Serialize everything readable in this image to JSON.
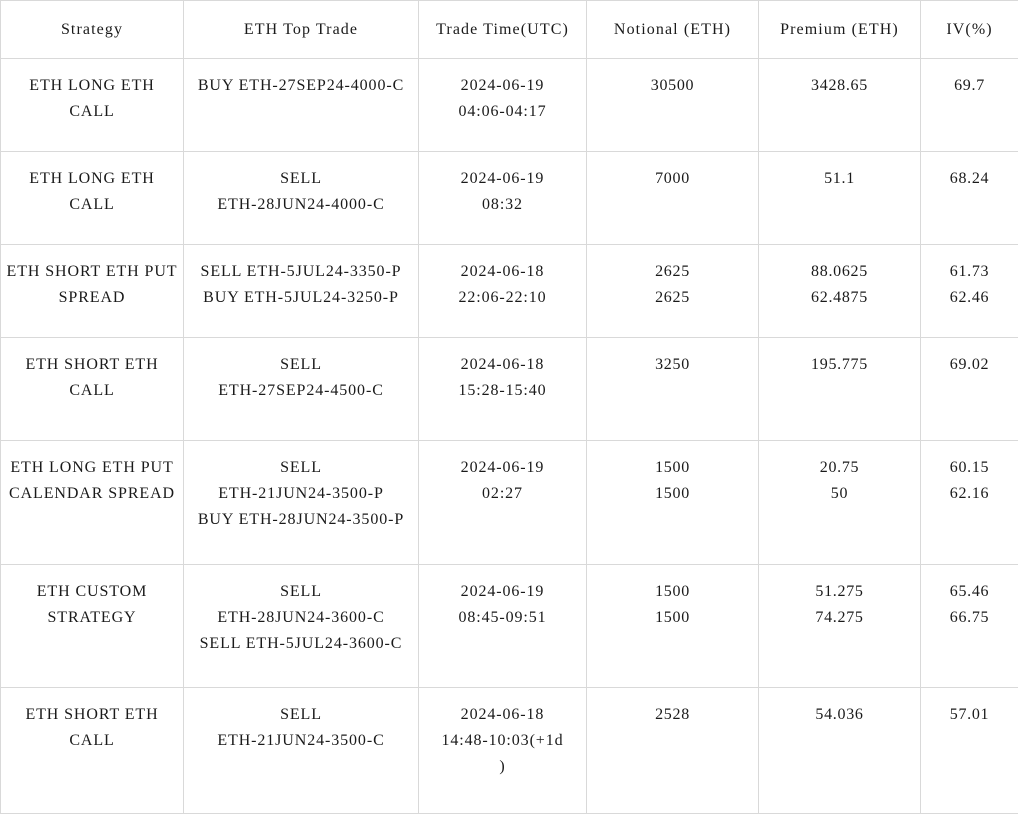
{
  "table": {
    "columns": [
      {
        "key": "strategy",
        "label": "Strategy"
      },
      {
        "key": "toptrade",
        "label": "ETH Top Trade"
      },
      {
        "key": "tradetime",
        "label": "Trade Time(UTC)"
      },
      {
        "key": "notional",
        "label": "Notional (ETH)"
      },
      {
        "key": "premium",
        "label": "Premium (ETH)"
      },
      {
        "key": "iv",
        "label": "IV(%)"
      }
    ],
    "rows": [
      {
        "strategy": [
          "ETH LONG ETH CALL"
        ],
        "toptrade": [
          "BUY ETH-27SEP24-4000-C"
        ],
        "tradetime": [
          "2024-06-19",
          "04:06-04:17"
        ],
        "notional": [
          "30500"
        ],
        "premium": [
          "3428.65"
        ],
        "iv": [
          "69.7"
        ]
      },
      {
        "strategy": [
          "ETH LONG ETH CALL"
        ],
        "toptrade": [
          "SELL",
          "ETH-28JUN24-4000-C"
        ],
        "tradetime": [
          "2024-06-19",
          "08:32"
        ],
        "notional": [
          "7000"
        ],
        "premium": [
          "51.1"
        ],
        "iv": [
          "68.24"
        ]
      },
      {
        "strategy": [
          "ETH SHORT ETH PUT",
          "SPREAD"
        ],
        "toptrade": [
          "SELL ETH-5JUL24-3350-P",
          "BUY ETH-5JUL24-3250-P"
        ],
        "tradetime": [
          "2024-06-18",
          "22:06-22:10"
        ],
        "notional": [
          "2625",
          "2625"
        ],
        "premium": [
          "88.0625",
          "62.4875"
        ],
        "iv": [
          "61.73",
          "62.46"
        ]
      },
      {
        "strategy": [
          "ETH SHORT ETH",
          "CALL"
        ],
        "toptrade": [
          "SELL",
          "ETH-27SEP24-4500-C"
        ],
        "tradetime": [
          "2024-06-18",
          "15:28-15:40"
        ],
        "notional": [
          "3250"
        ],
        "premium": [
          "195.775"
        ],
        "iv": [
          "69.02"
        ]
      },
      {
        "strategy": [
          "ETH LONG ETH PUT",
          "CALENDAR SPREAD"
        ],
        "toptrade": [
          "SELL",
          "ETH-21JUN24-3500-P",
          "BUY ETH-28JUN24-3500-P"
        ],
        "tradetime": [
          "2024-06-19",
          "02:27"
        ],
        "notional": [
          "1500",
          "1500"
        ],
        "premium": [
          "20.75",
          "50"
        ],
        "iv": [
          "60.15",
          "62.16"
        ]
      },
      {
        "strategy": [
          "ETH CUSTOM",
          "STRATEGY"
        ],
        "toptrade": [
          "SELL",
          "ETH-28JUN24-3600-C",
          "SELL ETH-5JUL24-3600-C"
        ],
        "tradetime": [
          "2024-06-19",
          "08:45-09:51"
        ],
        "notional": [
          "1500",
          "1500"
        ],
        "premium": [
          "51.275",
          "74.275"
        ],
        "iv": [
          "65.46",
          "66.75"
        ]
      },
      {
        "strategy": [
          "ETH SHORT ETH",
          "CALL"
        ],
        "toptrade": [
          "SELL",
          "ETH-21JUN24-3500-C"
        ],
        "tradetime": [
          "2024-06-18",
          "14:48-10:03(+1d",
          ")"
        ],
        "notional": [
          "2528"
        ],
        "premium": [
          "54.036"
        ],
        "iv": [
          "57.01"
        ]
      }
    ],
    "row_heights": [
      "r-h78",
      "r-h78",
      "r-h78",
      "r-h88",
      "r-h109",
      "r-h108",
      "r-h111"
    ],
    "colors": {
      "border": "#d9d9d9",
      "text": "#1a1a1a",
      "background": "#ffffff"
    }
  }
}
